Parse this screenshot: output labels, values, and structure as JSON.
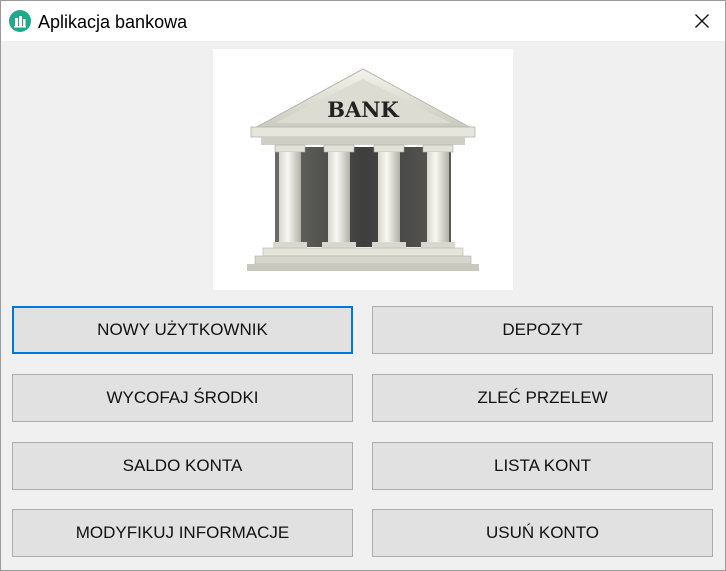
{
  "window": {
    "title": "Aplikacja bankowa",
    "app_icon": "bank-icon",
    "close_icon": "close-icon"
  },
  "image": {
    "sign_text": "BANK",
    "icon": "bank-building-icon"
  },
  "buttons": {
    "new_user": "NOWY UŻYTKOWNIK",
    "deposit": "DEPOZYT",
    "withdraw": "WYCOFAJ ŚRODKI",
    "transfer": "ZLEĆ PRZELEW",
    "balance": "SALDO KONTA",
    "account_list": "LISTA KONT",
    "modify_info": "MODYFIKUJ INFORMACJE",
    "delete_account": "USUŃ KONTO"
  },
  "colors": {
    "accent": "#0078d7",
    "app_icon": "#1fa88a",
    "button_bg": "#e1e1e1"
  }
}
